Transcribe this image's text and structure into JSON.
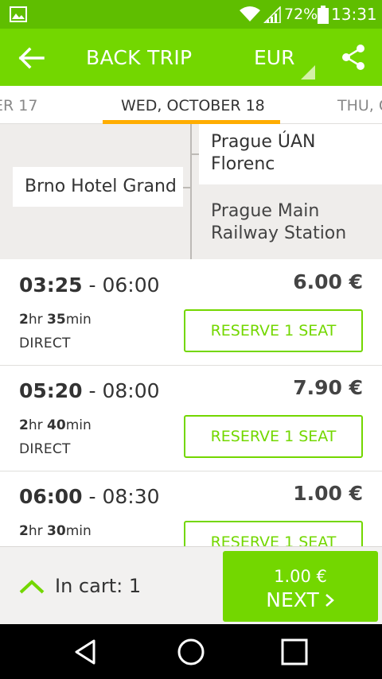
{
  "status_bar": {
    "battery_percent": "72%",
    "time": "13:31",
    "icons": [
      "gallery-icon",
      "wifi-icon",
      "signal-icon",
      "battery-icon"
    ]
  },
  "app_bar": {
    "title": "BACK TRIP",
    "currency": "EUR",
    "icons": [
      "back-arrow-icon",
      "share-icon"
    ]
  },
  "date_tabs": {
    "prev": "ER 17",
    "active": "WED, OCTOBER 18",
    "next": "THU, O"
  },
  "route": {
    "from": "Brno Hotel Grand",
    "to_1": "Prague ÚAN Florenc",
    "to_2": "Prague Main Railway Station"
  },
  "trips": [
    {
      "dep": "03:25",
      "arr": " - 06:00",
      "price": "6.00 €",
      "dur_h": "2",
      "dur_h_unit": "hr ",
      "dur_m": "35",
      "dur_m_unit": "min",
      "type": "DIRECT",
      "reserve": "RESERVE 1 SEAT"
    },
    {
      "dep": "05:20",
      "arr": " - 08:00",
      "price": "7.90 €",
      "dur_h": "2",
      "dur_h_unit": "hr ",
      "dur_m": "40",
      "dur_m_unit": "min",
      "type": "DIRECT",
      "reserve": "RESERVE 1 SEAT"
    },
    {
      "dep": "06:00",
      "arr": " - 08:30",
      "price": "1.00 €",
      "dur_h": "2",
      "dur_h_unit": "hr ",
      "dur_m": "30",
      "dur_m_unit": "min",
      "type": "",
      "reserve": "RESERVE 1 SEAT"
    }
  ],
  "cart": {
    "label": "In cart: 1",
    "next_price": "1.00 €",
    "next_label": "NEXT"
  },
  "colors": {
    "status_bar": "#5fbe00",
    "brand_green": "#73d700",
    "tab_underline": "#ffad00",
    "route_bg": "#efedeb"
  }
}
